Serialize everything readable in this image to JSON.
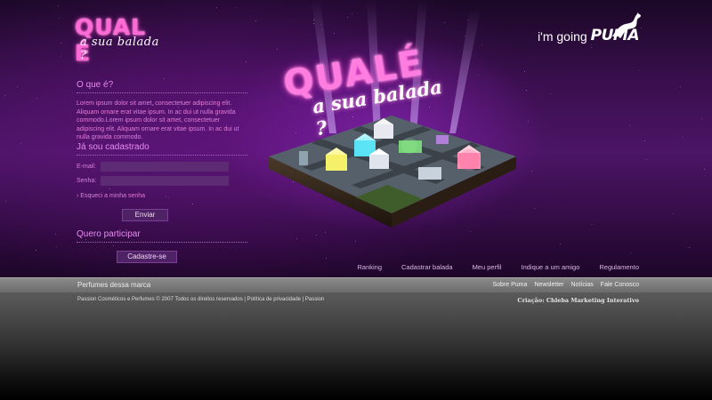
{
  "logo": {
    "line1": "QUAL É",
    "line2": "a sua balada ?"
  },
  "brand": {
    "going": "i'm going",
    "name": "PUMA"
  },
  "sections": {
    "about_title": "O que é?",
    "about_text": "Lorem ipsum dolor sit amet, consectetuer adipiscing elit. Aliquam ornare erat vitae ipsum. In ac dui ut nulla gravida commodo.Lorem ipsum dolor sit amet, consectetuer adipiscing elit. Aliquam ornare erat vitae ipsum. In ac dui ut nulla gravida commodo.",
    "registered_title": "Já sou cadastrado",
    "participate_title": "Quero participar"
  },
  "login": {
    "email_label": "E-mail:",
    "password_label": "Senha:",
    "forgot": "› Esqueci a minha senha",
    "submit": "Enviar"
  },
  "signup": {
    "button": "Cadastre-se"
  },
  "hero_logo": {
    "line1": "QUALÉ",
    "line2": "a sua balada ?"
  },
  "nav": [
    "Ranking",
    "Cadastrar balada",
    "Meu perfil",
    "Indique a um amigo",
    "Regulamento"
  ],
  "bar": {
    "left": "Perfumes dessa marca",
    "links": [
      "Sobre Puma",
      "Newsletter",
      "Notícias",
      "Fale Conosco"
    ]
  },
  "footer": {
    "copyright": "Passion Cosméticos e Perfumes © 2007 Todos os direitos reservados | Política de privacidade | Passion",
    "credit": "Criação: Chleba Marketing Interativo"
  },
  "colors": {
    "accent": "#e98bf2",
    "neon": "#ff6bd6",
    "bar": "#7b7b7b"
  }
}
